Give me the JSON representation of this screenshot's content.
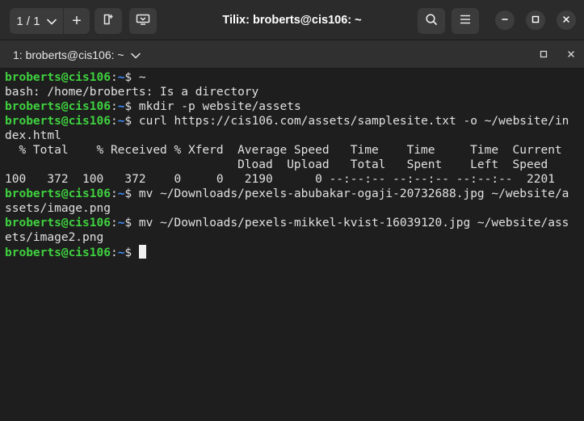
{
  "header": {
    "session_counter": "1 / 1",
    "add_label": "+",
    "window_title": "Tilix: broberts@cis106: ~"
  },
  "terminal_tab": {
    "title": "1: broberts@cis106: ~"
  },
  "prompt": {
    "user_host": "broberts@cis106",
    "colon": ":",
    "path": "~",
    "symbol": "$ "
  },
  "terminal": {
    "lines": [
      {
        "kind": "prompt",
        "cmd": "~"
      },
      {
        "kind": "output",
        "text": "bash: /home/broberts: Is a directory"
      },
      {
        "kind": "prompt",
        "cmd": "mkdir -p website/assets"
      },
      {
        "kind": "prompt",
        "cmd": "curl https://cis106.com/assets/samplesite.txt -o ~/website/in"
      },
      {
        "kind": "output",
        "text": "dex.html"
      },
      {
        "kind": "output",
        "text": "  % Total    % Received % Xferd  Average Speed   Time    Time     Time  Current"
      },
      {
        "kind": "output",
        "text": "                                 Dload  Upload   Total   Spent    Left  Speed"
      },
      {
        "kind": "output",
        "text": "100   372  100   372    0     0   2190      0 --:--:-- --:--:-- --:--:--  2201"
      },
      {
        "kind": "prompt",
        "cmd": "mv ~/Downloads/pexels-abubakar-ogaji-20732688.jpg ~/website/a"
      },
      {
        "kind": "output",
        "text": "ssets/image.png"
      },
      {
        "kind": "prompt",
        "cmd": "mv ~/Downloads/pexels-mikkel-kvist-16039120.jpg ~/website/ass"
      },
      {
        "kind": "output",
        "text": "ets/image2.png"
      },
      {
        "kind": "prompt",
        "cmd": "",
        "cursor": true
      }
    ]
  },
  "colors": {
    "prompt_user": "#3fd13f",
    "prompt_path": "#3f8fff",
    "background": "#1e1e1e",
    "text": "#e0e0e0"
  },
  "icons": {
    "session_dropdown": "chevron-down-icon",
    "add_terminal": "plus-icon",
    "split": "split-add-icon",
    "tablet": "sync-input-icon",
    "search": "search-icon",
    "menu": "hamburger-menu-icon",
    "minimize": "minimize-icon",
    "maximize": "maximize-icon",
    "close": "close-icon",
    "tab_dropdown": "chevron-down-icon",
    "tab_maximize": "maximize-icon",
    "tab_close": "close-icon"
  }
}
